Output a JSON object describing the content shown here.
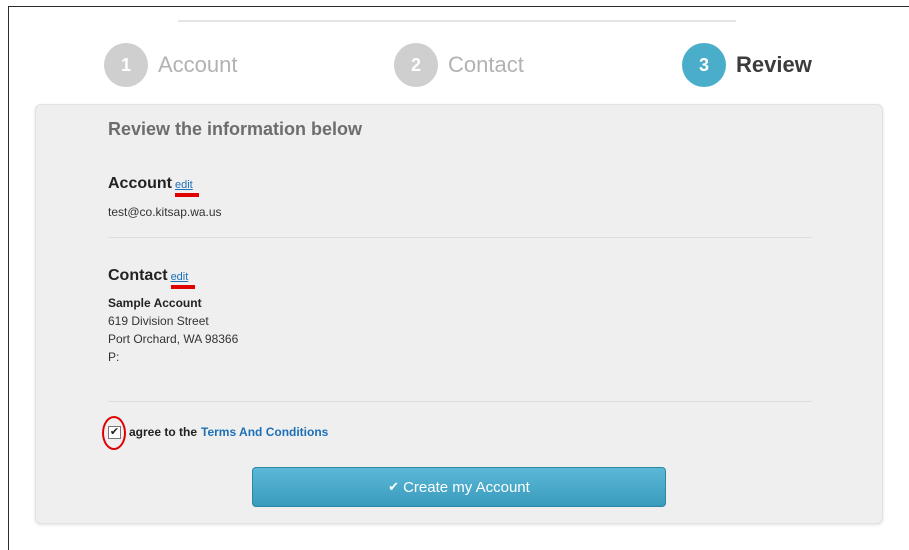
{
  "steps": [
    {
      "number": "1",
      "label": "Account"
    },
    {
      "number": "2",
      "label": "Contact"
    },
    {
      "number": "3",
      "label": "Review"
    }
  ],
  "review": {
    "title": "Review the information below",
    "account": {
      "heading": "Account",
      "edit": "edit",
      "email": "test@co.kitsap.wa.us"
    },
    "contact": {
      "heading": "Contact",
      "edit": "edit",
      "name": "Sample Account",
      "street": "619 Division Street",
      "city": "Port Orchard, WA 98366",
      "phone": "P:"
    },
    "agree": {
      "checked": true,
      "text": "agree to the",
      "terms_link": "Terms And Conditions"
    },
    "submit_label": "Create my Account"
  },
  "colors": {
    "accent": "#4aaecb",
    "link": "#1d6fb8",
    "annotation": "#e00000"
  }
}
